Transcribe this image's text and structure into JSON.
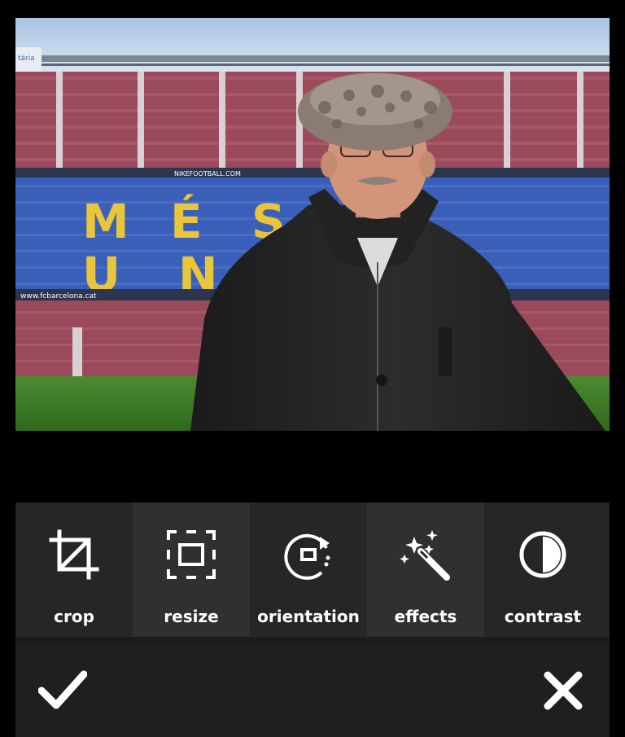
{
  "tools": [
    {
      "label": "crop",
      "icon": "crop-icon"
    },
    {
      "label": "resize",
      "icon": "resize-icon"
    },
    {
      "label": "orientation",
      "icon": "rotate-icon"
    },
    {
      "label": "effects",
      "icon": "magic-wand-icon"
    },
    {
      "label": "contrast",
      "icon": "contrast-icon"
    }
  ],
  "actions": {
    "accept_icon": "checkmark-icon",
    "cancel_icon": "close-icon"
  },
  "photo": {
    "sign_left": "tària",
    "banner_top": "NIKEFOOTBALL.COM",
    "banner_bottom": "www.fcbarcelona.cat",
    "seat_letters": [
      "M",
      "É",
      "S",
      "U",
      "N"
    ]
  },
  "colors": {
    "toolbar_bg": "#262626",
    "actionbar_bg": "#1f1f1f",
    "seat_red": "#9a4a5a",
    "seat_blue": "#3a5fb8",
    "seat_yellow": "#e8c53a"
  }
}
